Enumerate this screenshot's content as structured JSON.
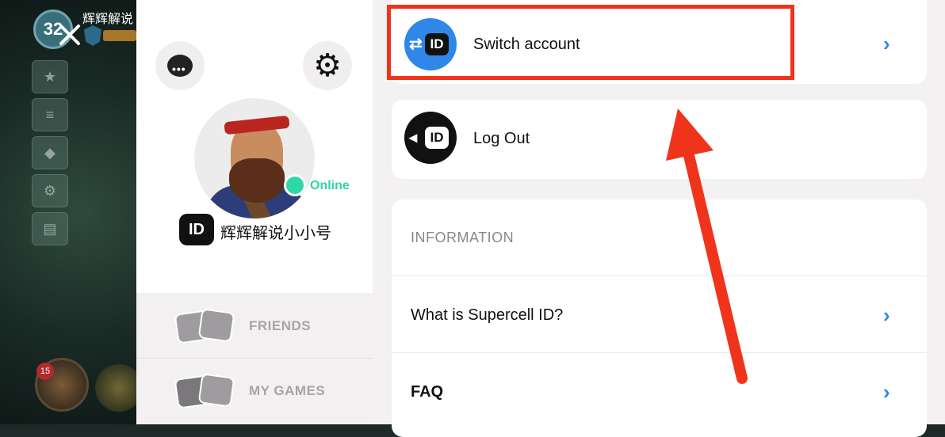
{
  "game": {
    "level": "32",
    "player_name": "辉辉解说",
    "close_icon": "close-icon",
    "hammer_count": "15",
    "side_buttons": [
      {
        "icon": "star-icon",
        "glyph": "★"
      },
      {
        "icon": "leaderboard-icon",
        "glyph": "≡"
      },
      {
        "icon": "clan-icon",
        "glyph": "◆"
      },
      {
        "icon": "gears-icon",
        "glyph": "⚙"
      },
      {
        "icon": "news-icon",
        "glyph": "▤"
      }
    ]
  },
  "profile": {
    "status": "Online",
    "id_badge": "ID",
    "name": "辉辉解说小小号",
    "chat_icon": "chat-bubble-icon",
    "settings_icon": "gear-icon",
    "nav": {
      "friends": "FRIENDS",
      "my_games": "MY GAMES"
    }
  },
  "menu": {
    "switch_account": "Switch account",
    "log_out": "Log Out",
    "id_chip": "ID",
    "chevron": "›",
    "information_header": "INFORMATION",
    "what_is": "What is Supercell ID?",
    "faq": "FAQ"
  },
  "colors": {
    "accent_blue": "#2f87e7",
    "online_green": "#2fd6a6",
    "highlight_red": "#f0341c"
  }
}
